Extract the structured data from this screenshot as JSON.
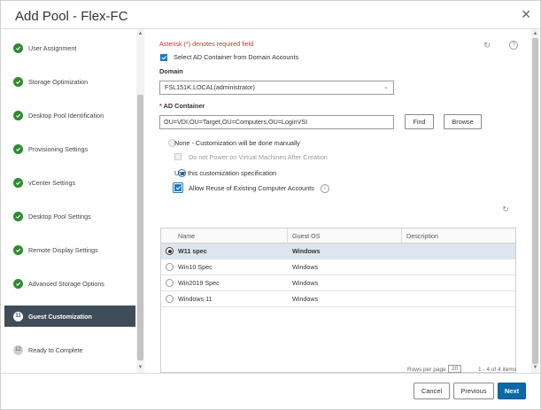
{
  "dialog": {
    "title": "Add Pool - Flex-FC",
    "close_icon": "close-icon"
  },
  "steps": [
    {
      "label": "User Assignment",
      "state": "done"
    },
    {
      "label": "Storage Optimization",
      "state": "done"
    },
    {
      "label": "Desktop Pool Identification",
      "state": "done"
    },
    {
      "label": "Provisioning Settings",
      "state": "done"
    },
    {
      "label": "vCenter Settings",
      "state": "done"
    },
    {
      "label": "Desktop Pool Settings",
      "state": "done"
    },
    {
      "label": "Remote Display Settings",
      "state": "done"
    },
    {
      "label": "Advanced Storage Options",
      "state": "done"
    },
    {
      "label": "Guest Customization",
      "state": "active",
      "number": "11"
    },
    {
      "label": "Ready to Complete",
      "state": "pending",
      "number": "12"
    }
  ],
  "form": {
    "required_note": "Asterisk (*) denotes required field",
    "select_ad_label": "Select AD Container from Domain Accounts",
    "domain_label": "Domain",
    "domain_value": "FSL151K.LOCAL(administrator)",
    "ad_container_label": "AD Container",
    "ad_required_mark": "*",
    "ad_container_value": "OU=VDI,OU=Target,OU=Computers,OU=LoginVSI",
    "find_label": "Find",
    "browse_label": "Browse",
    "none_label": "None - Customization will be done manually",
    "no_power_label": "Do not Power on Virtual Machines After Creation",
    "use_spec_label": "Use this customization specification",
    "allow_reuse_label": "Allow Reuse of Existing Computer Accounts",
    "info_icon": "i",
    "help_icon": "?"
  },
  "table": {
    "headers": {
      "name": "Name",
      "guest_os": "Guest OS",
      "description": "Description"
    },
    "rows": [
      {
        "name": "W11 spec",
        "guest_os": "Windows",
        "description": "",
        "selected": true
      },
      {
        "name": "Win10 Spec",
        "guest_os": "Windows",
        "description": "",
        "selected": false
      },
      {
        "name": "Win2019 Spec",
        "guest_os": "Windows",
        "description": "",
        "selected": false
      },
      {
        "name": "Windows 11",
        "guest_os": "Windows",
        "description": "",
        "selected": false
      }
    ],
    "footer_rows_per_page": "Rows per page",
    "footer_page_size": "20",
    "footer_range": "1 - 4 of 4 items"
  },
  "footer": {
    "cancel_label": "Cancel",
    "previous_label": "Previous",
    "next_label": "Next"
  },
  "colors": {
    "accent": "#0b69a8",
    "active_step": "#3f4d5a",
    "done": "#2e8b2e",
    "required": "#c0392b"
  }
}
